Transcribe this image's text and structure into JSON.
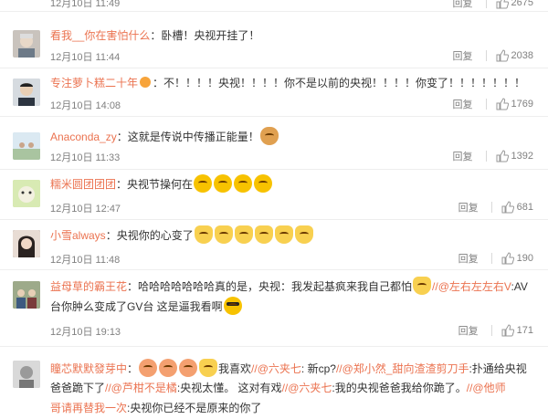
{
  "comments": [
    {
      "time": "12月10日 11:49",
      "reply": "回复",
      "likes": "2675"
    },
    {
      "user": "看我__你在害怕什么",
      "content": "：卧槽！央视开挂了！",
      "time": "12月10日 11:44",
      "reply": "回复",
      "likes": "2038"
    },
    {
      "user": "专注萝卜糕二十年",
      "content": "：不！！！！央视！！！！你不是以前的央视！！！！你变了！！！！！！！",
      "time": "12月10日 14:08",
      "reply": "回复",
      "likes": "1769"
    },
    {
      "user": "Anaconda_zy",
      "content": "：这就是传说中传播正能量！",
      "time": "12月10日 11:33",
      "reply": "回复",
      "likes": "1392"
    },
    {
      "user": "糯米圆团团团",
      "content": "：央视节操何在",
      "time": "12月10日 12:47",
      "reply": "回复",
      "likes": "681"
    },
    {
      "user": "小雪always",
      "content": "：央视你的心变了",
      "time": "12月10日 11:48",
      "reply": "回复",
      "likes": "190"
    },
    {
      "user": "益母草的霸王花",
      "content_a": "：哈哈哈哈哈哈哈真的是，央视：我发起基疯来我自己都怕",
      "mention1": "//@左右左左右V",
      "content_b": ":AV",
      "line2": "台你肿么变成了GV台 这是逼我看啊",
      "time": "12月10日 19:13",
      "reply": "回复",
      "likes": "171"
    },
    {
      "user": "瞳芯默默發芽中",
      "content_a": "：",
      "content_b": "我喜欢",
      "mention1": "//@六夹七",
      "content_c": ": 新cp?",
      "mention2": "//@郑小然_甜向渣渣剪刀手",
      "content_d": ":扑通给央视",
      "line2a": "爸爸跪下了",
      "mention3": "//@芦柑不是橘",
      "line2b": ":央视太懂。",
      "line2c": " 这对有戏",
      "mention4": "//@六夹七",
      "line2d": ":我的央视爸爸我给你跪了。",
      "mention5": "//@他师",
      "line3a": "哥请再替我一次",
      "line3b": ":央视你已经不是原来的你了"
    }
  ]
}
